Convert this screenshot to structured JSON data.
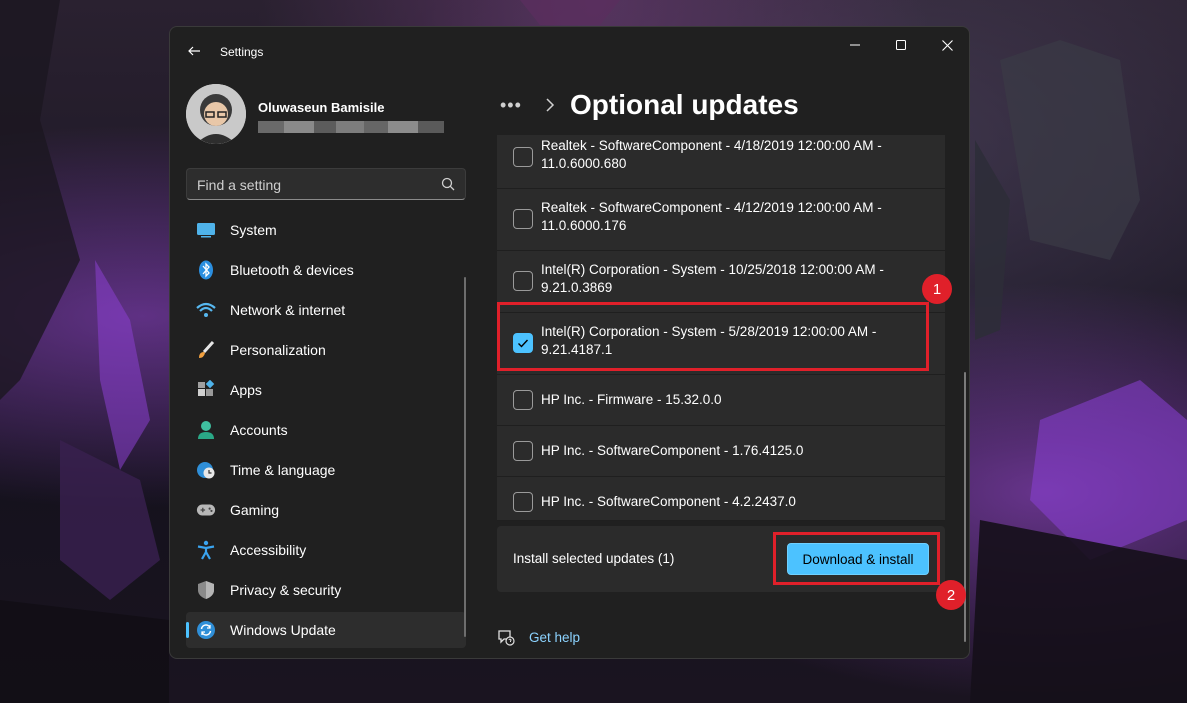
{
  "window": {
    "app_title": "Settings"
  },
  "profile": {
    "name": "Oluwaseun Bamisile"
  },
  "search": {
    "placeholder": "Find a setting"
  },
  "sidebar": {
    "items": [
      {
        "label": "System",
        "icon": "system-icon"
      },
      {
        "label": "Bluetooth & devices",
        "icon": "bluetooth-icon"
      },
      {
        "label": "Network & internet",
        "icon": "wifi-icon"
      },
      {
        "label": "Personalization",
        "icon": "brush-icon"
      },
      {
        "label": "Apps",
        "icon": "apps-icon"
      },
      {
        "label": "Accounts",
        "icon": "person-icon"
      },
      {
        "label": "Time & language",
        "icon": "globe-clock-icon"
      },
      {
        "label": "Gaming",
        "icon": "gamepad-icon"
      },
      {
        "label": "Accessibility",
        "icon": "accessibility-icon"
      },
      {
        "label": "Privacy & security",
        "icon": "shield-icon"
      },
      {
        "label": "Windows Update",
        "icon": "update-icon",
        "active": true
      }
    ]
  },
  "breadcrumb": {
    "more": "•••",
    "title": "Optional updates"
  },
  "updates": [
    {
      "line1": "Realtek - SoftwareComponent - 4/18/2019 12:00:00 AM -",
      "line2": "11.0.6000.680",
      "checked": false
    },
    {
      "line1": "Realtek - SoftwareComponent - 4/12/2019 12:00:00 AM -",
      "line2": "11.0.6000.176",
      "checked": false
    },
    {
      "line1": "Intel(R) Corporation - System - 10/25/2018 12:00:00 AM -",
      "line2": "9.21.0.3869",
      "checked": false
    },
    {
      "line1": "Intel(R) Corporation - System - 5/28/2019 12:00:00 AM -",
      "line2": "9.21.4187.1",
      "checked": true
    },
    {
      "line1": "HP Inc. - Firmware - 15.32.0.0",
      "line2": "",
      "checked": false
    },
    {
      "line1": "HP Inc. - SoftwareComponent - 1.76.4125.0",
      "line2": "",
      "checked": false
    },
    {
      "line1": "HP Inc. - SoftwareComponent - 4.2.2437.0",
      "line2": "",
      "checked": false
    }
  ],
  "install": {
    "label": "Install selected updates (1)",
    "button": "Download & install"
  },
  "help": {
    "label": "Get help"
  },
  "annotations": {
    "marker1": "1",
    "marker2": "2"
  },
  "colors": {
    "accent": "#4cc2ff",
    "annotation_red": "#e0202a",
    "window_bg": "#202020",
    "card_bg": "#2b2b2b"
  }
}
